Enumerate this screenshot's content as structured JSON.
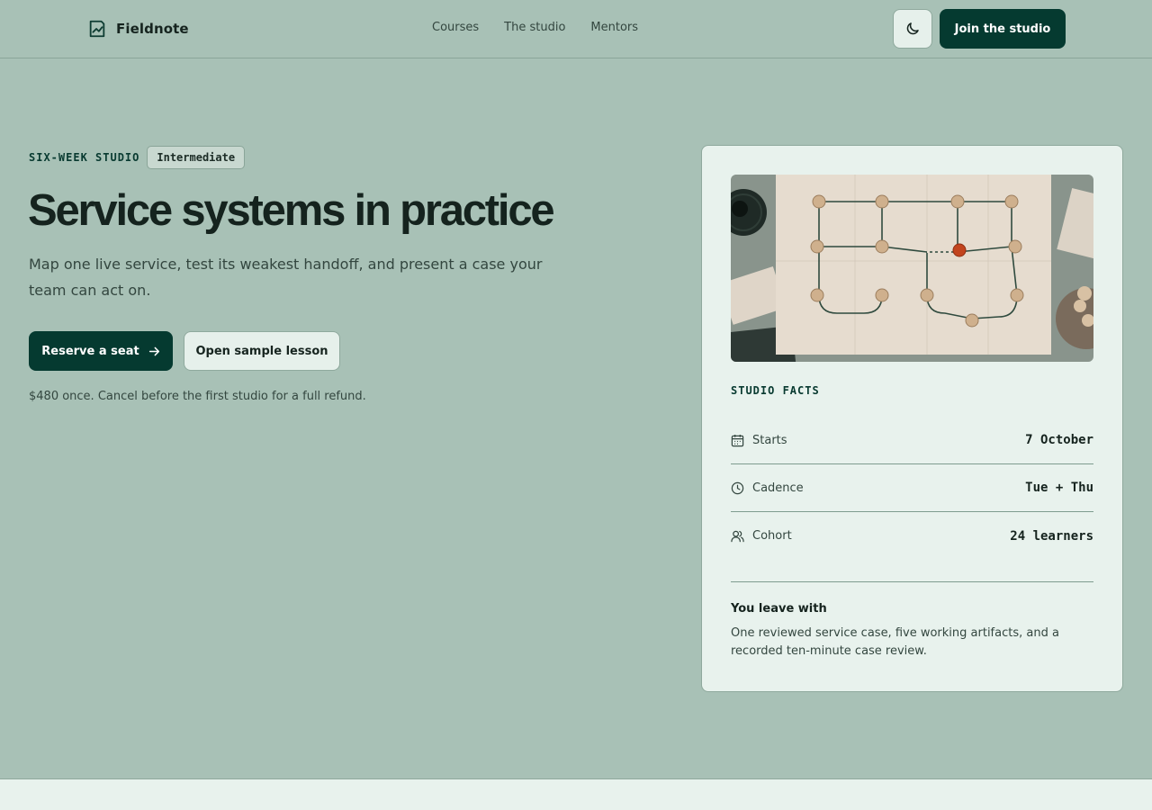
{
  "header": {
    "brand": "Fieldnote",
    "brand_icon": "chart-line-icon",
    "nav": [
      {
        "label": "Courses"
      },
      {
        "label": "The studio"
      },
      {
        "label": "Mentors"
      }
    ],
    "theme_toggle_icon": "moon-icon",
    "cta_label": "Join the studio"
  },
  "hero": {
    "eyebrow": "SIX-WEEK STUDIO",
    "level": "Intermediate",
    "title": "Service systems in practice",
    "subtitle": "Map one live service, test its weakest handoff, and present a case your team can act on.",
    "primary_label": "Reserve a seat",
    "primary_icon": "arrow-right-icon",
    "secondary_label": "Open sample lesson",
    "price_note": "$480 once. Cancel before the first studio for a full refund."
  },
  "facts": {
    "heading": "STUDIO FACTS",
    "rows": [
      {
        "icon": "calendar-icon",
        "label": "Starts",
        "value": "7 October"
      },
      {
        "icon": "clock-icon",
        "label": "Cadence",
        "value": "Tue + Thu"
      },
      {
        "icon": "users-icon",
        "label": "Cohort",
        "value": "24 learners"
      }
    ],
    "leave_title": "You leave with",
    "leave_body": "One reviewed service case, five working artifacts, and a recorded ten-minute case review."
  },
  "colors": {
    "page_bg": "#a8c1b6",
    "accent": "#053a30",
    "card_bg": "#e8f2ed",
    "marker_highlight": "#c2441e"
  }
}
